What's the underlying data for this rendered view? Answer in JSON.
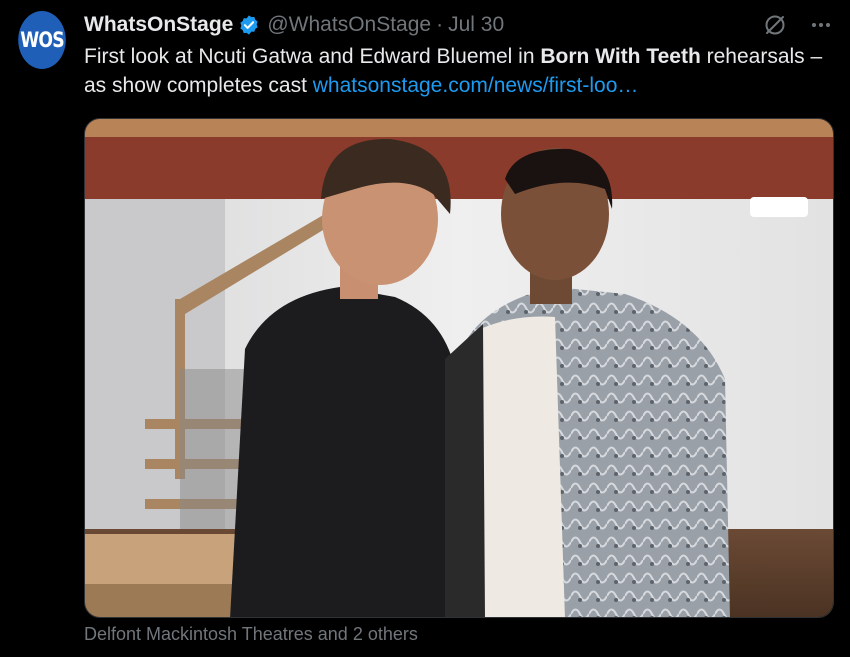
{
  "author": {
    "avatar_text": "WOS",
    "display_name": "WhatsOnStage",
    "handle": "@WhatsOnStage",
    "separator": "·",
    "date": "Jul 30",
    "verified_icon": "verified-badge-icon"
  },
  "actions": {
    "grok_icon": "slashed-circle-icon",
    "more_icon": "more-dots-icon"
  },
  "tweet": {
    "text_part1": "First look at Ncuti Gatwa and Edward Bluemel in ",
    "text_bold": "Born With Teeth",
    "text_part2": " rehearsals – as show completes cast ",
    "link": "whatsonstage.com/news/first-loo…"
  },
  "media": {
    "description_icon": "photo-image"
  },
  "tagged": {
    "text": "Delfont Mackintosh Theatres and 2 others"
  },
  "colors": {
    "background": "#000000",
    "text": "#e7e9ea",
    "muted": "#71767b",
    "link": "#1d9bf0",
    "avatar": "#1f5fb8"
  }
}
